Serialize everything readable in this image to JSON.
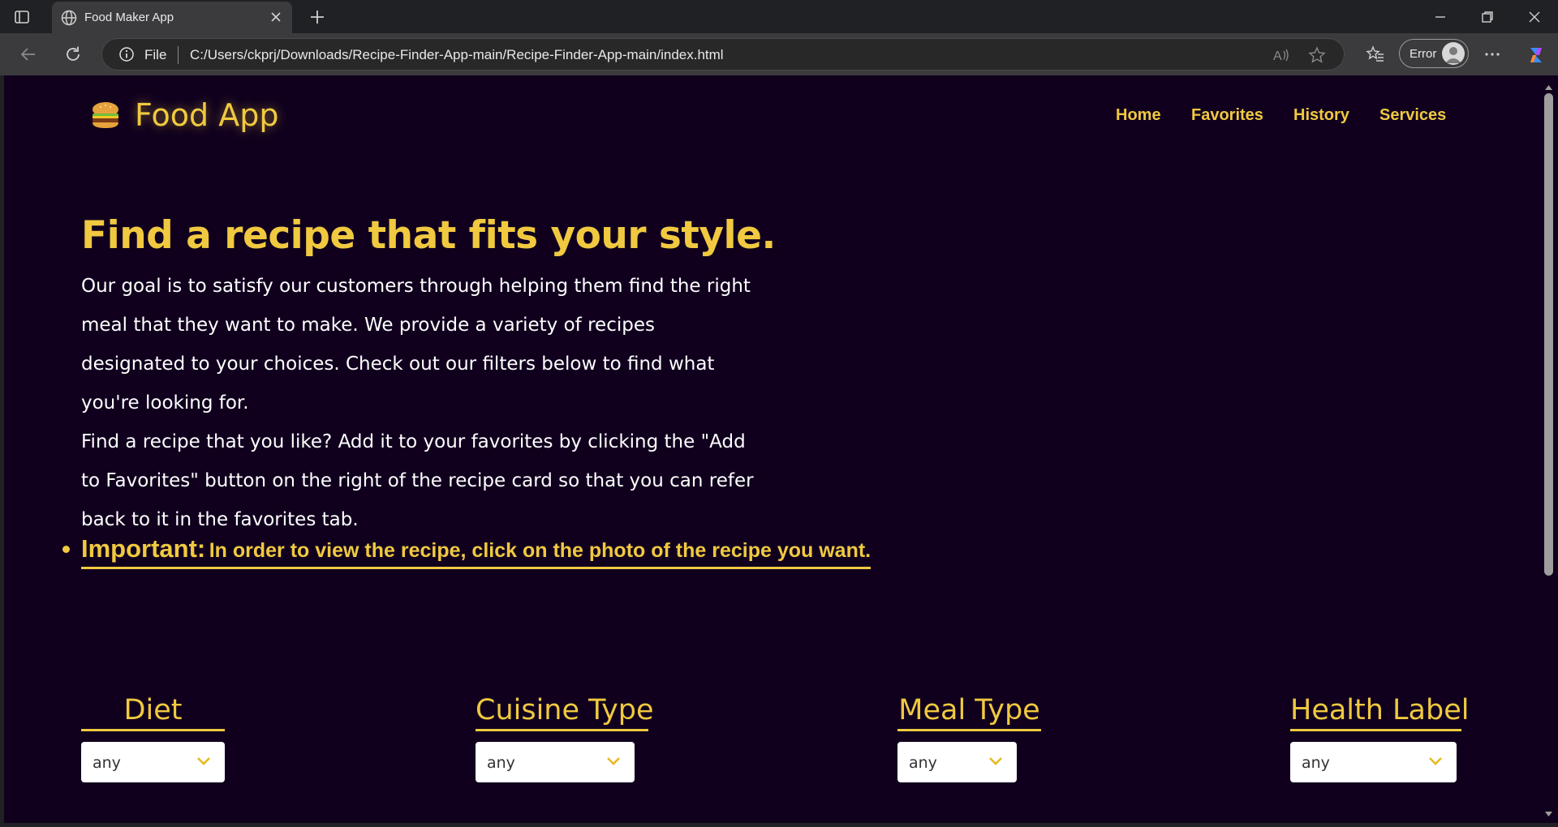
{
  "browser": {
    "tab_title": "Food Maker App",
    "address_scheme": "File",
    "address_url": "C:/Users/ckprj/Downloads/Recipe-Finder-App-main/Recipe-Finder-App-main/index.html",
    "profile_status": "Error"
  },
  "page": {
    "brand": "Food App",
    "brand_icon": "burger-emoji",
    "nav": [
      "Home",
      "Favorites",
      "History",
      "Services"
    ],
    "hero_title": "Find a recipe that fits your style.",
    "intro_paragraph_1": "Our goal is to satisfy our customers through helping them find the right meal that they want to make. We provide a variety of recipes designated to your choices. Check out our filters below to find what you're looking for.",
    "intro_paragraph_2": "Find a recipe that you like? Add it to your favorites by clicking the \"Add to Favorites\" button on the right of the recipe card so that you can refer back to it in the favorites tab.",
    "important_label": "Important:",
    "important_text": "In order to view the recipe, click on the photo of the recipe you want.",
    "filters": [
      {
        "label": "Diet",
        "value": "any"
      },
      {
        "label": "Cuisine Type",
        "value": "any"
      },
      {
        "label": "Meal Type",
        "value": "any"
      },
      {
        "label": "Health Label",
        "value": "any"
      }
    ]
  },
  "colors": {
    "page_bg": "#10001e",
    "accent": "#f0c940",
    "text": "#ffffff"
  }
}
